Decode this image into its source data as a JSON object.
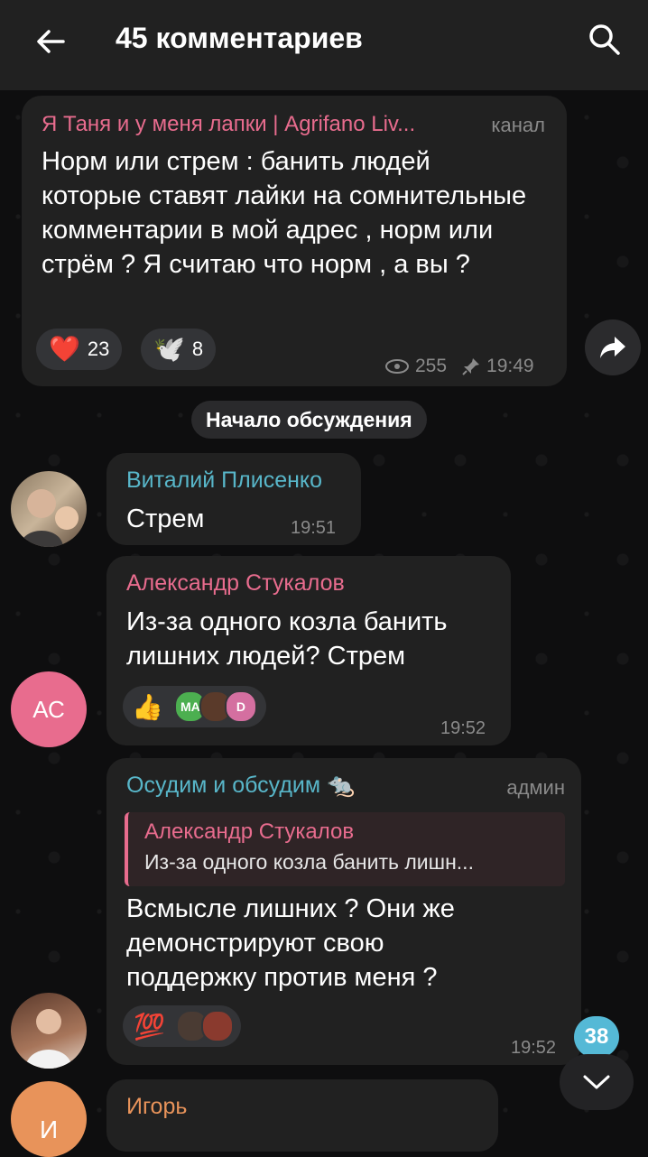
{
  "header": {
    "title": "45 комментариев",
    "back_icon": "arrow-left-icon",
    "search_icon": "search-icon"
  },
  "post": {
    "channel": "Я Таня и у меня лапки | Agrifano Liv...",
    "tag": "канал",
    "text": "Норм или стрем : банить людей которые ставят лайки на сомнительные комментарии в мой адрес , норм или стрём ? Я считаю что норм , а вы ?",
    "reactions": [
      {
        "emoji": "❤️",
        "count": "23"
      },
      {
        "emoji": "🕊️",
        "count": "8"
      }
    ],
    "views": "255",
    "time": "19:49"
  },
  "divider": "Начало обсуждения",
  "comments": [
    {
      "author": "Виталий Плисенко",
      "text": "Стрем",
      "time": "19:51",
      "author_color": "#58b6c9"
    },
    {
      "author": "Александр Стукалов",
      "avatar_initials": "АС",
      "text": "Из-за одного козла банить лишних людей? Стрем",
      "time": "19:52",
      "author_color": "#e86c8e",
      "reaction_emoji": "👍",
      "reactor_initials": [
        "МА",
        "",
        "D"
      ]
    },
    {
      "author": "Осудим и обсудим 🐀",
      "tag": "админ",
      "author_color": "#58b6c9",
      "reply": {
        "author": "Александр Стукалов",
        "text": "Из-за одного козла банить лишн..."
      },
      "text": "Всмысле лишних ? Они же демонстрируют свою поддержку против меня ?",
      "reaction_emoji": "💯",
      "time": "19:52"
    },
    {
      "author": "Игорь",
      "avatar_initials": "И",
      "author_color": "#e8935a"
    }
  ],
  "unread_count": "38",
  "colors": {
    "accent_pink": "#e86c8e",
    "accent_teal": "#58b6c9",
    "badge": "#55b9d6"
  }
}
